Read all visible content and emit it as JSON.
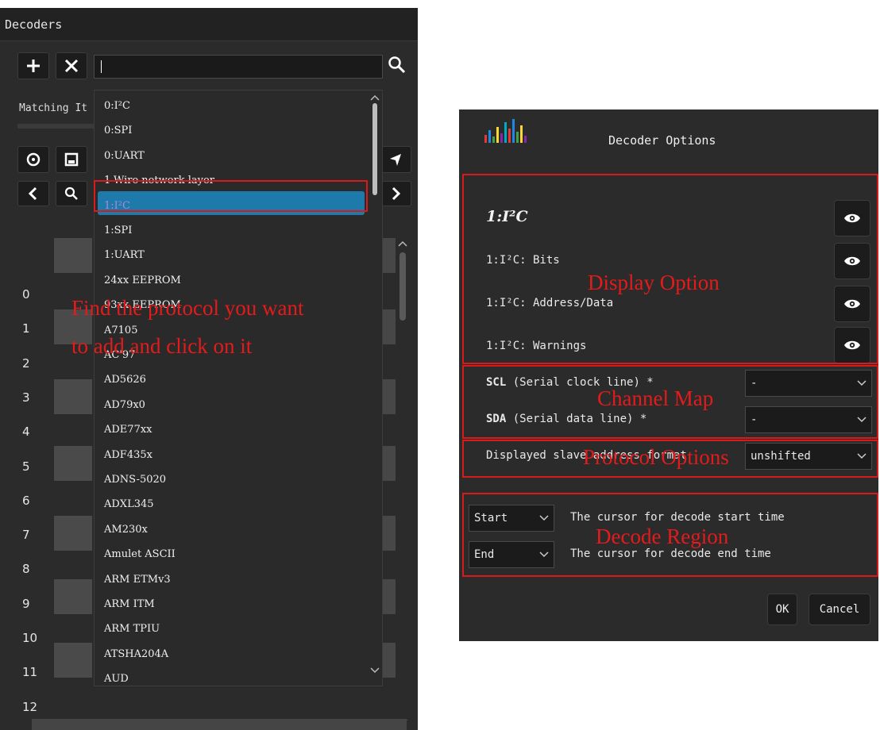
{
  "left_panel": {
    "title": "Decoders",
    "search": {
      "value": ""
    },
    "matching_label": "Matching It",
    "row_numbers": [
      "0",
      "1",
      "2",
      "3",
      "4",
      "5",
      "6",
      "7",
      "8",
      "9",
      "10",
      "11",
      "12"
    ],
    "dropdown": {
      "items": [
        "0:I²C",
        "0:SPI",
        "0:UART",
        "1-Wire network layer",
        "1:I²C",
        "1:SPI",
        "1:UART",
        "24xx EEPROM",
        "93xx EEPROM",
        "A7105",
        "AC'97",
        "AD5626",
        "AD79x0",
        "ADE77xx",
        "ADF435x",
        "ADNS-5020",
        "ADXL345",
        "AM230x",
        "Amulet ASCII",
        "ARM ETMv3",
        "ARM ITM",
        "ARM TPIU",
        "ATSHA204A",
        "AUD"
      ],
      "selected": "1:I²C"
    },
    "annotation": [
      "Find the protocol you want",
      "to add and click on it"
    ]
  },
  "dialog": {
    "title": "Decoder Options",
    "decoder_name": "1:I²C",
    "display_rows": [
      "1:I²C: Bits",
      "1:I²C: Address/Data",
      "1:I²C: Warnings"
    ],
    "channels": [
      {
        "bold": "SCL",
        "rest": "(Serial clock line) *",
        "value": "-"
      },
      {
        "bold": "SDA",
        "rest": "(Serial data line) *",
        "value": "-"
      }
    ],
    "protocol_option": {
      "label": "Displayed slave address format",
      "value": "unshifted"
    },
    "region": [
      {
        "value": "Start",
        "text": "The cursor for decode start time"
      },
      {
        "value": "End",
        "text": "The cursor for decode end time"
      }
    ],
    "buttons": {
      "ok": "OK",
      "cancel": "Cancel"
    },
    "annotations": {
      "display": "Display Option",
      "channel": "Channel Map",
      "protocol": "Protocol Options",
      "region": "Decode Region"
    },
    "logo_colors": [
      "#e53935",
      "#1e88e5",
      "#43a047",
      "#fdd835",
      "#8e24aa",
      "#00acc1"
    ]
  }
}
